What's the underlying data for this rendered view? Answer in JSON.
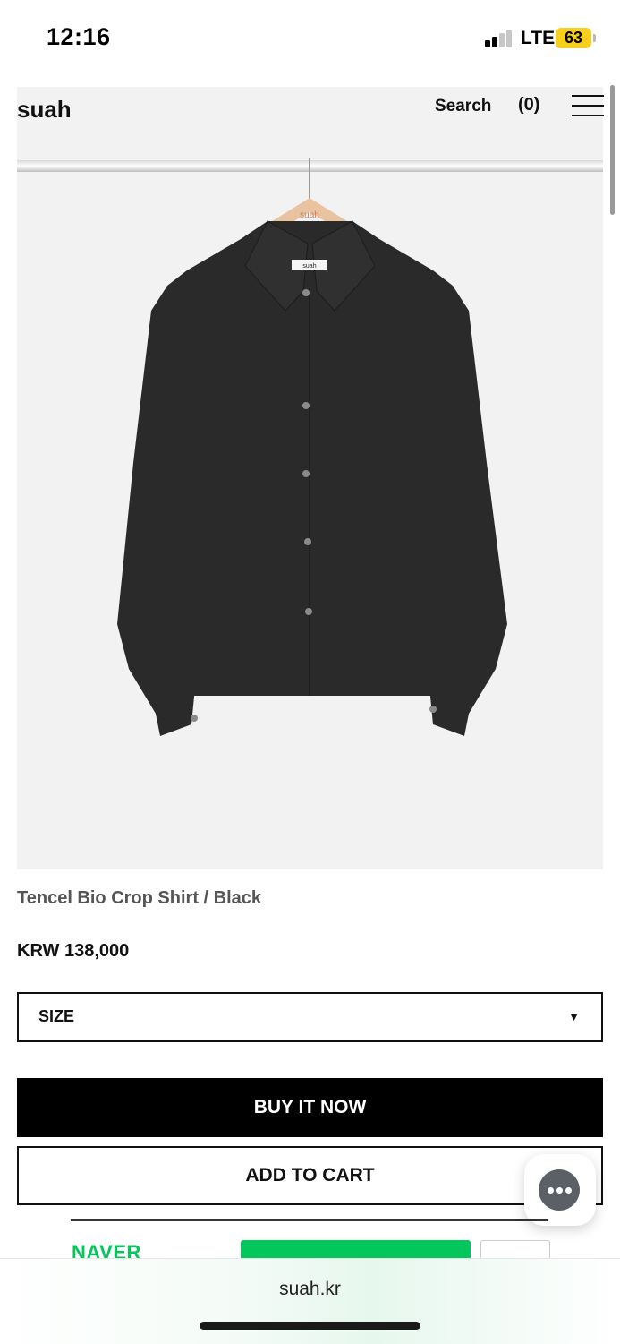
{
  "status_bar": {
    "time": "12:16",
    "network": "LTE",
    "battery": "63"
  },
  "header": {
    "logo": "suah",
    "search": "Search",
    "cart": "(0)"
  },
  "hero": {
    "hanger_brand": "suah",
    "label_brand": "suah",
    "garment_color": "#2a2a2a"
  },
  "product": {
    "name": "Tencel Bio Crop Shirt / Black",
    "price": "KRW 138,000"
  },
  "options": {
    "size_label": "SIZE",
    "caret": "▼"
  },
  "actions": {
    "buy_now": "BUY IT NOW",
    "add_to_cart": "ADD TO CART"
  },
  "naver": {
    "brand": "NAVER",
    "brand_color": "#03c75a"
  },
  "browser": {
    "url": "suah.kr"
  }
}
